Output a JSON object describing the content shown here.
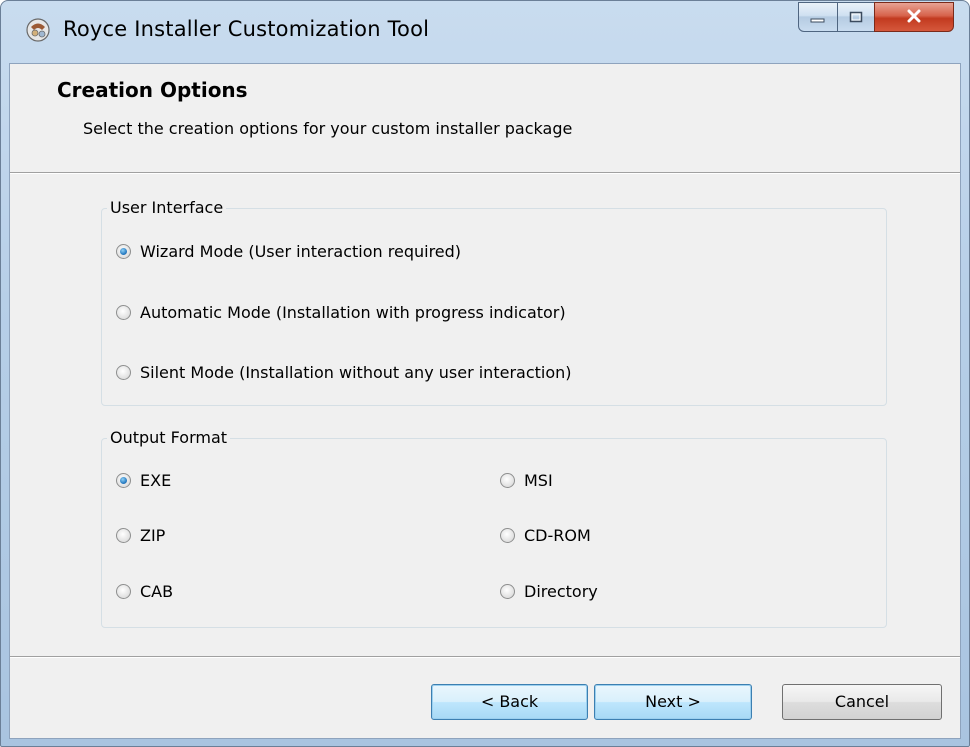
{
  "window": {
    "title": "Royce Installer Customization Tool",
    "app_icon": "installer-app-icon",
    "controls": {
      "minimize_icon": "minimize-icon",
      "maximize_icon": "maximize-icon",
      "close_icon": "close-icon"
    }
  },
  "header": {
    "title": "Creation Options",
    "subtitle": "Select the creation options for your custom installer package"
  },
  "user_interface": {
    "label": "User Interface",
    "options": [
      {
        "label": "Wizard Mode (User interaction required)",
        "selected": true
      },
      {
        "label": "Automatic Mode (Installation with progress indicator)",
        "selected": false
      },
      {
        "label": "Silent Mode (Installation without any user interaction)",
        "selected": false
      }
    ]
  },
  "output_format": {
    "label": "Output Format",
    "options": [
      {
        "label": "EXE",
        "selected": true
      },
      {
        "label": "MSI",
        "selected": false
      },
      {
        "label": "ZIP",
        "selected": false
      },
      {
        "label": "CD-ROM",
        "selected": false
      },
      {
        "label": "CAB",
        "selected": false
      },
      {
        "label": "Directory",
        "selected": false
      }
    ]
  },
  "buttons": {
    "back": "< Back",
    "next": "Next >",
    "cancel": "Cancel"
  },
  "colors": {
    "accent": "#2a7ec4",
    "close_red": "#c23a1f",
    "frame": "#b7cfe8",
    "client_bg": "#f0f0f0"
  }
}
